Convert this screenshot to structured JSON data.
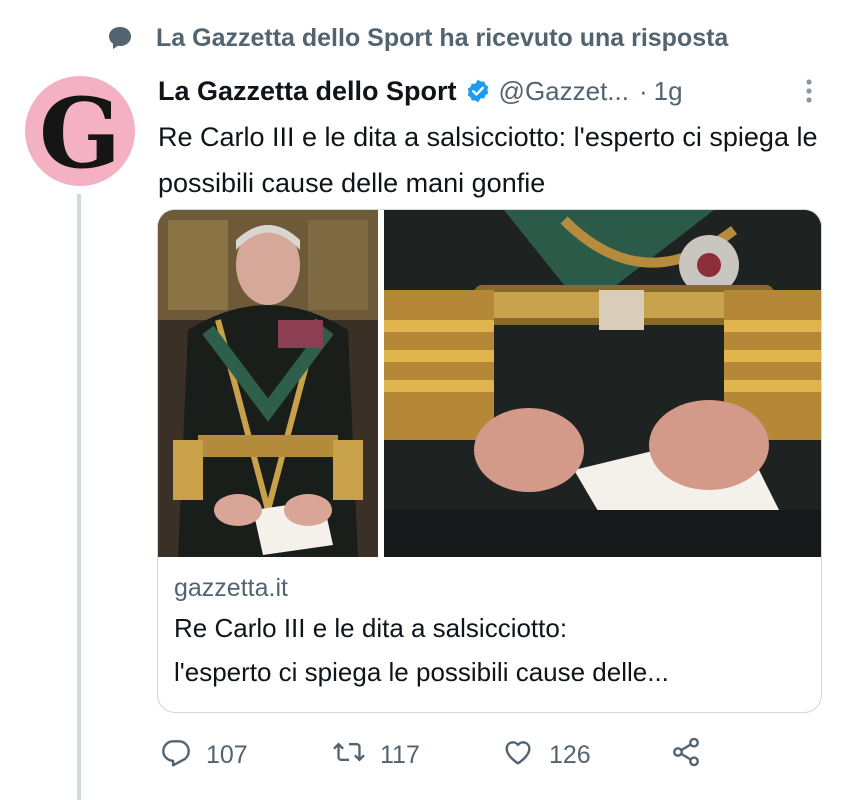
{
  "context": {
    "text": "La Gazzetta dello Sport ha ricevuto una risposta",
    "icon": "speech-bubble-icon"
  },
  "avatar": {
    "letter": "G",
    "color": "#f4b1c4"
  },
  "author": {
    "name": "La Gazzetta dello Sport",
    "verified_color": "#1d9bf0",
    "handle": "@Gazzet...",
    "separator": "·",
    "time": "1g"
  },
  "tweet": {
    "text": "Re Carlo III e le dita a salsicciotto: l'esperto ci spiega le possibili cause delle mani gonfie"
  },
  "card": {
    "domain": "gazzetta.it",
    "title_line1": "Re Carlo III e le dita a salsicciotto:",
    "title_line2": "l'esperto ci spiega le possibili cause delle..."
  },
  "actions": {
    "replies": "107",
    "retweets": "117",
    "likes": "126"
  }
}
